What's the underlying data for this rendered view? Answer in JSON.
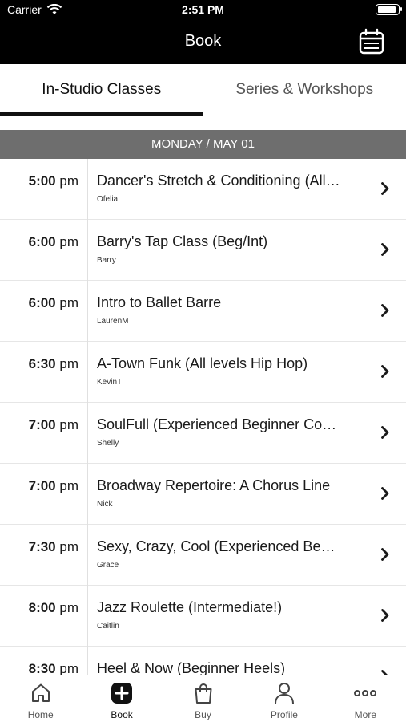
{
  "status_bar": {
    "carrier": "Carrier",
    "time": "2:51 PM"
  },
  "nav": {
    "title": "Book",
    "calendar_icon": "calendar-icon"
  },
  "tabs": [
    {
      "label": "In-Studio Classes",
      "active": true
    },
    {
      "label": "Series & Workshops",
      "active": false
    }
  ],
  "day_header": "MONDAY / MAY 01",
  "classes": [
    {
      "time": "5:00",
      "ampm": "pm",
      "name": "Dancer's Stretch & Conditioning (All…",
      "instructor": "Ofelia"
    },
    {
      "time": "6:00",
      "ampm": "pm",
      "name": "Barry's Tap Class (Beg/Int)",
      "instructor": "Barry"
    },
    {
      "time": "6:00",
      "ampm": "pm",
      "name": "Intro to Ballet Barre",
      "instructor": "LaurenM"
    },
    {
      "time": "6:30",
      "ampm": "pm",
      "name": "A-Town Funk (All levels Hip Hop)",
      "instructor": "KevinT"
    },
    {
      "time": "7:00",
      "ampm": "pm",
      "name": "SoulFull (Experienced Beginner Co…",
      "instructor": "Shelly"
    },
    {
      "time": "7:00",
      "ampm": "pm",
      "name": "Broadway Repertoire: A Chorus Line",
      "instructor": "Nick"
    },
    {
      "time": "7:30",
      "ampm": "pm",
      "name": "Sexy, Crazy, Cool (Experienced Be…",
      "instructor": "Grace"
    },
    {
      "time": "8:00",
      "ampm": "pm",
      "name": "Jazz Roulette (Intermediate!)",
      "instructor": "Caitlin"
    },
    {
      "time": "8:30",
      "ampm": "pm",
      "name": "Heel & Now (Beginner Heels)",
      "instructor": ""
    }
  ],
  "tab_bar": [
    {
      "label": "Home",
      "icon": "home-icon",
      "active": false
    },
    {
      "label": "Book",
      "icon": "plus-square-icon",
      "active": true
    },
    {
      "label": "Buy",
      "icon": "shopping-bag-icon",
      "active": false
    },
    {
      "label": "Profile",
      "icon": "person-icon",
      "active": false
    },
    {
      "label": "More",
      "icon": "more-dots-icon",
      "active": false
    }
  ],
  "colors": {
    "header_bg": "#000000",
    "day_header_bg": "#6e6e6e",
    "active_tab": "#111111"
  }
}
